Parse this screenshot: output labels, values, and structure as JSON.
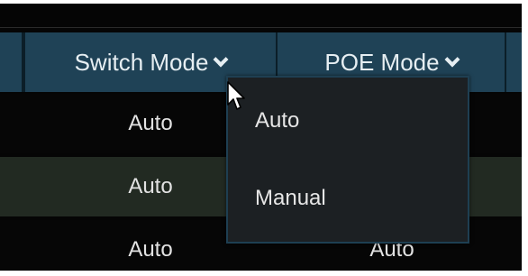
{
  "header": {
    "switch_mode_label": "Switch Mode",
    "poe_mode_label": "POE Mode"
  },
  "rows": [
    {
      "switch_mode": "Auto",
      "poe_mode": ""
    },
    {
      "switch_mode": "Auto",
      "poe_mode": ""
    },
    {
      "switch_mode": "Auto",
      "poe_mode": "Auto"
    }
  ],
  "dropdown": {
    "options": [
      "Auto",
      "Manual"
    ]
  },
  "colors": {
    "header_bg": "#1f4256",
    "panel_bg": "#050505",
    "selected_row_bg": "#222a22",
    "dropdown_bg": "#1c2023",
    "dropdown_border": "#1e3f52",
    "text": "#e6e6e6"
  },
  "icons": {
    "header_chevron": "chevron-down-icon",
    "cursor": "mouse-pointer-icon"
  }
}
